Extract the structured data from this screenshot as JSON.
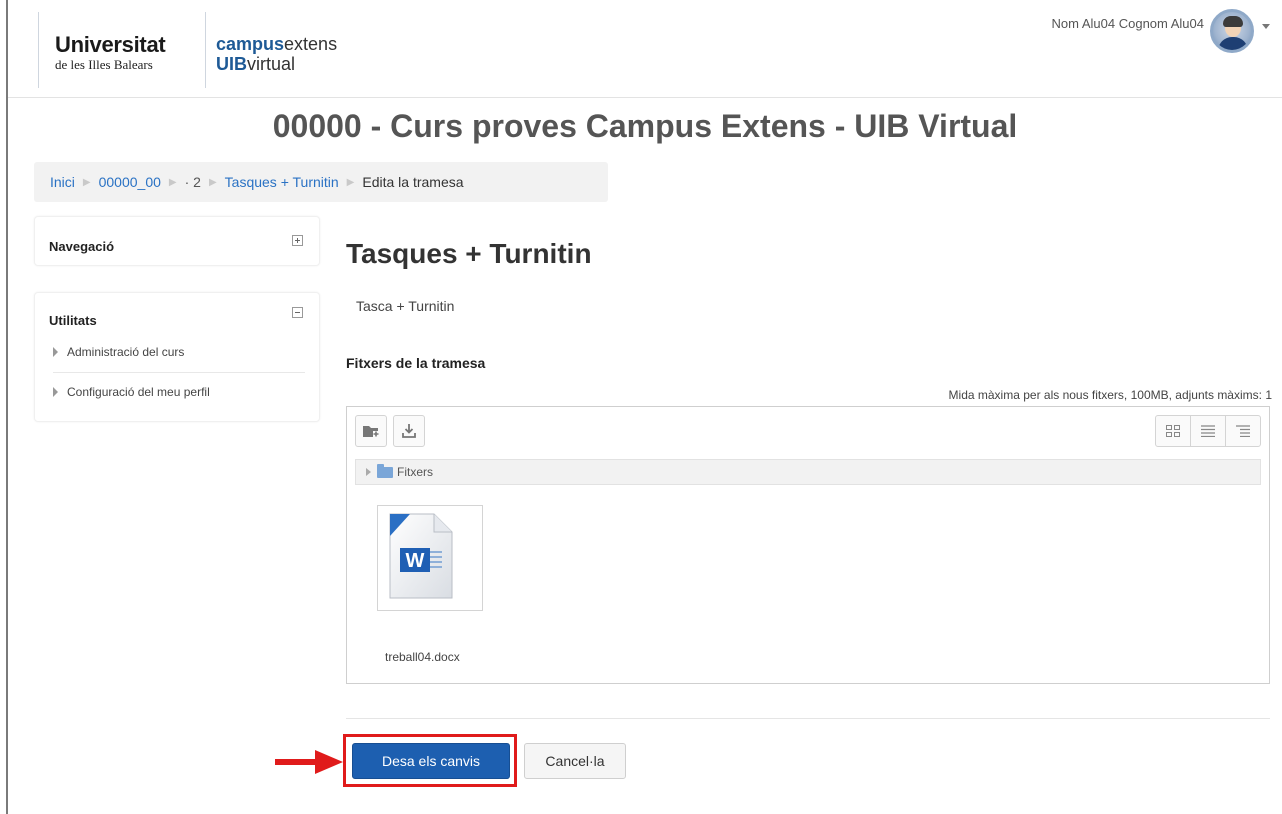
{
  "header": {
    "logo": {
      "university_line1": "Universitat",
      "university_line2": "de les Illes Balears",
      "campus_bold": "campus",
      "campus_rest": "extens",
      "uib_bold": "UIB",
      "uib_rest": "virtual"
    },
    "user_name": "Nom Alu04 Cognom Alu04"
  },
  "course_title": "00000 - Curs proves Campus Extens - UIB Virtual",
  "breadcrumb": {
    "items": [
      "Inici",
      "00000_00",
      "· 2",
      "Tasques + Turnitin",
      "Edita la tramesa"
    ]
  },
  "blocks": {
    "navigation": {
      "title": "Navegació"
    },
    "utilities": {
      "title": "Utilitats",
      "items": [
        "Administració del curs",
        "Configuració del meu perfil"
      ]
    }
  },
  "main": {
    "title": "Tasques + Turnitin",
    "description": "Tasca + Turnitin",
    "section_label": "Fitxers de la tramesa",
    "max_size_note": "Mida màxima per als nous fitxers, 100MB, adjunts màxims: 1",
    "filepicker": {
      "path_label": "Fitxers",
      "files": [
        {
          "name": "treball04.docx",
          "icon": "word-docx-icon"
        }
      ]
    }
  },
  "actions": {
    "save_label": "Desa els canvis",
    "cancel_label": "Cancel·la"
  },
  "colors": {
    "link": "#2a72c4",
    "primary_button": "#1d5fb0",
    "annotation_red": "#e01b1b"
  }
}
